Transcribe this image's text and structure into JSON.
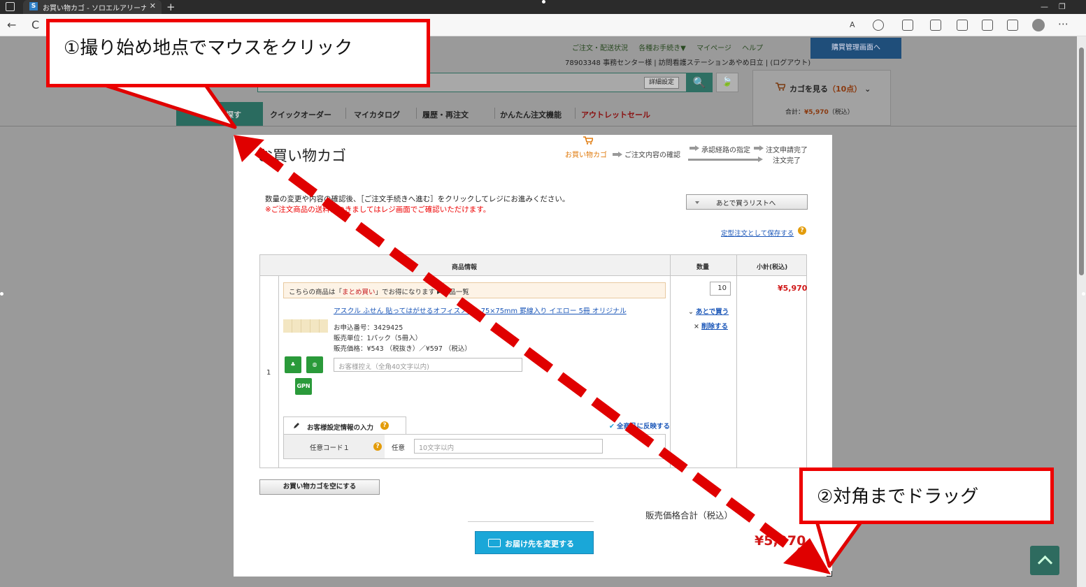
{
  "browser": {
    "tab_title": "お買い物カゴ - ソロエルアリーナ Powe",
    "tab_close": "✕",
    "new_tab": "+",
    "back": "←",
    "reload": "C",
    "favicon": "S",
    "read_aloud": "A",
    "more": "⋯",
    "minimize": "—",
    "restore": "❐"
  },
  "site": {
    "top_links": [
      "ご注文・配送状況",
      "各種お手続き▼",
      "マイページ",
      "ヘルプ"
    ],
    "user_line": "78903348 事務センター様 | 訪問看護ステーションあやめ日立 | (ログアウト)",
    "mgmt_button": "購買管理画面へ",
    "search_detail": "詳細設定",
    "search_icon": "🔍",
    "leaf_icon": "🍃",
    "cart_label": "カゴを見る",
    "cart_count": "（10点）",
    "cart_caret": "⌄",
    "cart_total_label": "合計：",
    "cart_total_amount": "¥5,970",
    "cart_total_tax": "（税込）",
    "menu_find": "ら探す",
    "menu_items": [
      "クイックオーダー",
      "マイカタログ",
      "履歴・再注文",
      "かんたん注文機能",
      "アウトレットセール"
    ]
  },
  "cart": {
    "title": "お買い物カゴ",
    "steps": {
      "current": "お買い物カゴ",
      "confirm": "ご注文内容の確認",
      "approval": "承認経路の指定",
      "applied": "注文申請完了",
      "done": "注文完了"
    },
    "intro": "数量の変更や内容の確認後、［ご注文手続きへ進む］をクリックしてレジにお進みください。",
    "warning": "※ご注文商品の送料につきましてはレジ画面でご確認いただけます。",
    "later_list_button": "あとで買うリストへ",
    "save_regular_link": "定型注文として保存する",
    "table_headers": {
      "product": "商品情報",
      "qty": "数量",
      "subtotal": "小計(税込)"
    },
    "row_number": "1",
    "matome_prefix": "こちらの商品は「",
    "matome_highlight": "まとめ買い",
    "matome_suffix": "」でお得になります ▸ 商品一覧",
    "product_name": "アスクル ふせん 貼ってはがせるオフィスノート75×75mm 罫線入り イエロー 5冊 オリジナル",
    "order_no": "お申込番号：3429425",
    "unit": "販売単位：1パック（5冊入）",
    "price": "販売価格：¥543 （税抜き）／¥597 （税込）",
    "memo_placeholder": "お客様控え（全角40文字以内)",
    "gpn_badge": "GPN",
    "customer_tab": "お客様設定情報の入力",
    "apply_all_link": "全商品に反映する",
    "custom_code_label": "任意コード１",
    "optional_label": "任意",
    "custom_input_placeholder": "10文字以内",
    "qty_value": "10",
    "buy_later_link": "あとで買う",
    "buy_later_prefix": "⌄",
    "delete_link": "削除する",
    "delete_prefix": "×",
    "subtotal_value": "¥5,970",
    "empty_cart_button": "お買い物カゴを空にする",
    "total_label": "販売価格合計（税込）",
    "change_delivery_button": "お届け先を変更する",
    "total_amount": "¥5,970"
  },
  "annotations": {
    "step1": "①撮り始め地点でマウスをクリック",
    "step2": "②対角までドラッグ",
    "color": "#e00000"
  }
}
